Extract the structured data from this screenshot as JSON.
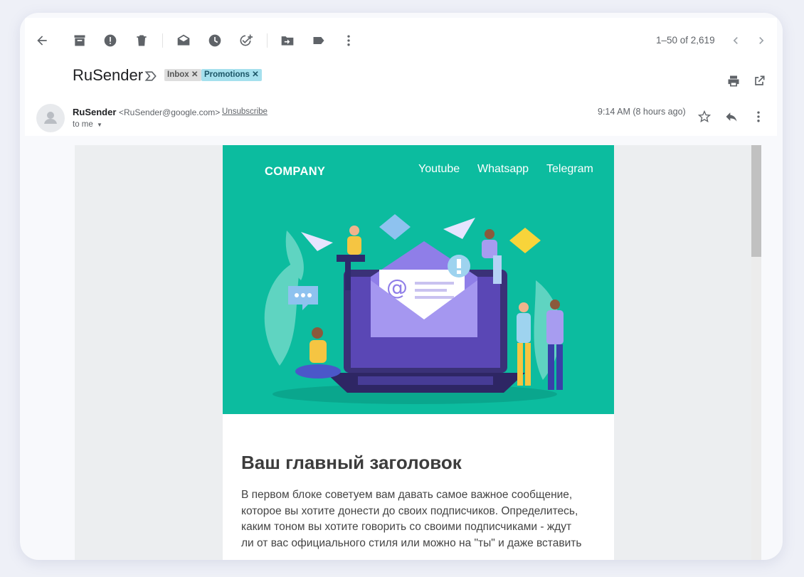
{
  "toolbar": {
    "icons": [
      "back-arrow-icon",
      "archive-icon",
      "report-spam-icon",
      "delete-icon",
      "mark-unread-icon",
      "snooze-icon",
      "add-task-icon",
      "move-to-icon",
      "label-icon",
      "more-vert-icon"
    ],
    "pager_text": "1–50 of 2,619"
  },
  "thread": {
    "subject": "RuSender",
    "labels": [
      "Inbox",
      "Promotions"
    ]
  },
  "message": {
    "sender_name": "RuSender",
    "sender_email": "<RuSender@google.com>",
    "unsubscribe": "Unsubscribe",
    "recipient": "to me",
    "time": "9:14 AM (8 hours ago)"
  },
  "email": {
    "company": "COMPANY",
    "nav": [
      "Youtube",
      "Whatsapp",
      "Telegram"
    ],
    "colors": {
      "hero_bg": "#0cbc9f",
      "promo_label": "#a5e0ed"
    },
    "headline": "Ваш главный заголовок",
    "body": "В первом блоке советуем вам давать самое важное сообщение,\nкоторое вы  хотите донести до своих подписчиков. Определитесь,\nкаким тоном вы хотите говорить со своими подписчиками - ждут\nли от вас официального стиля или можно на \"ты\" и даже вставить"
  }
}
